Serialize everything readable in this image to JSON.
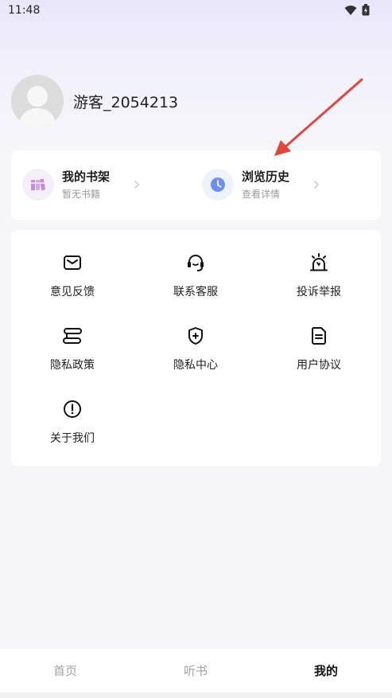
{
  "status_bar": {
    "time": "11:48"
  },
  "profile": {
    "username": "游客_2054213"
  },
  "quick_cards": [
    {
      "title": "我的书架",
      "subtitle": "暂无书籍",
      "icon": "bookshelf-icon"
    },
    {
      "title": "浏览历史",
      "subtitle": "查看详情",
      "icon": "clock-icon"
    }
  ],
  "menu_items": [
    {
      "label": "意见反馈",
      "icon": "mail-icon"
    },
    {
      "label": "联系客服",
      "icon": "headset-icon"
    },
    {
      "label": "投诉举报",
      "icon": "alarm-icon"
    },
    {
      "label": "隐私政策",
      "icon": "policy-icon"
    },
    {
      "label": "隐私中心",
      "icon": "shield-icon"
    },
    {
      "label": "用户协议",
      "icon": "document-icon"
    },
    {
      "label": "关于我们",
      "icon": "info-icon"
    }
  ],
  "tabs": [
    {
      "label": "首页"
    },
    {
      "label": "听书"
    },
    {
      "label": "我的"
    }
  ],
  "colors": {
    "accent": "#e2453a",
    "active_tab": "#111111",
    "inactive_tab": "#a3a3a3"
  }
}
